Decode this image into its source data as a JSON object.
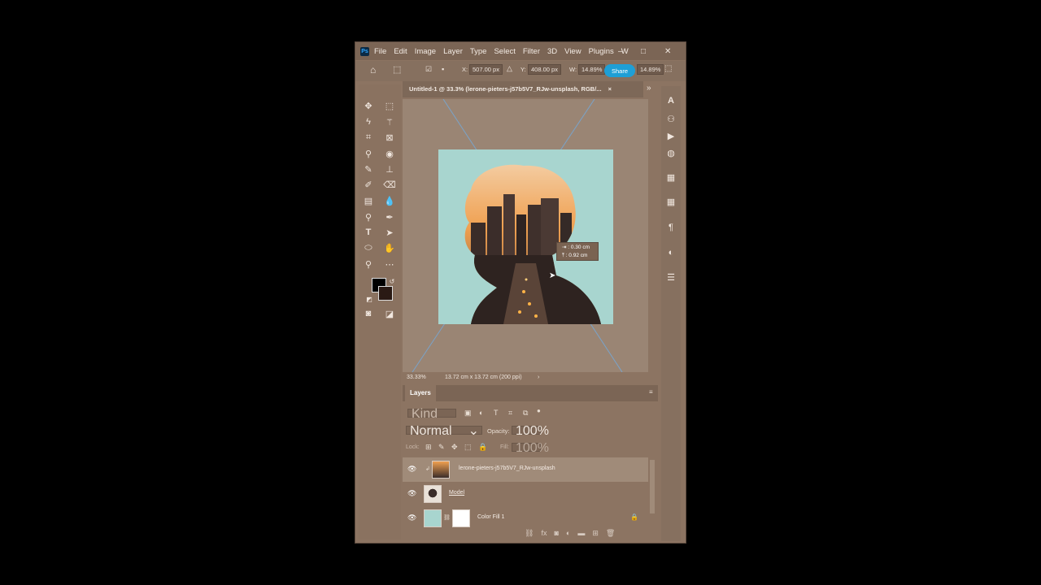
{
  "app": {
    "icon": "Ps"
  },
  "menu": [
    "File",
    "Edit",
    "Image",
    "Layer",
    "Type",
    "Select",
    "Filter",
    "3D",
    "View",
    "Plugins",
    "W"
  ],
  "window_controls": {
    "minimize": "–",
    "maximize": "□",
    "close": "✕"
  },
  "options_bar": {
    "x_label": "X:",
    "x_value": "507.00 px",
    "y_label": "Y:",
    "y_value": "408.00 px",
    "w_label": "W:",
    "w_value": "14.89%",
    "share_label": "Share",
    "h_value": "14.89%"
  },
  "document": {
    "tab_title": "Untitled-1 @ 33.3% (lerone-pieters-j57b5V7_RJw-unsplash, RGB/...",
    "close": "×",
    "zoom": "33.33%",
    "doc_info": "13.72 cm x 13.72 cm (200 ppi)",
    "arrow": "›"
  },
  "tooltip": {
    "line1": "⇥ : 0.30 cm",
    "line2": "⤒ : 0.92 cm"
  },
  "layers_panel": {
    "tab": "Layers",
    "kind_placeholder": "Kind",
    "blend_mode": "Normal",
    "opacity_label": "Opacity:",
    "opacity_value": "100%",
    "lock_label": "Lock:",
    "fill_label": "Fill:",
    "fill_value": "100%",
    "layers": [
      {
        "name": "lerone-pieters-j57b5V7_RJw-unsplash"
      },
      {
        "name": "Model"
      },
      {
        "name": "Color Fill 1"
      }
    ]
  },
  "colors": {
    "accent": "#1e9fd6",
    "canvas_bg": "#a8d5cf",
    "chrome": "#8c7462"
  }
}
